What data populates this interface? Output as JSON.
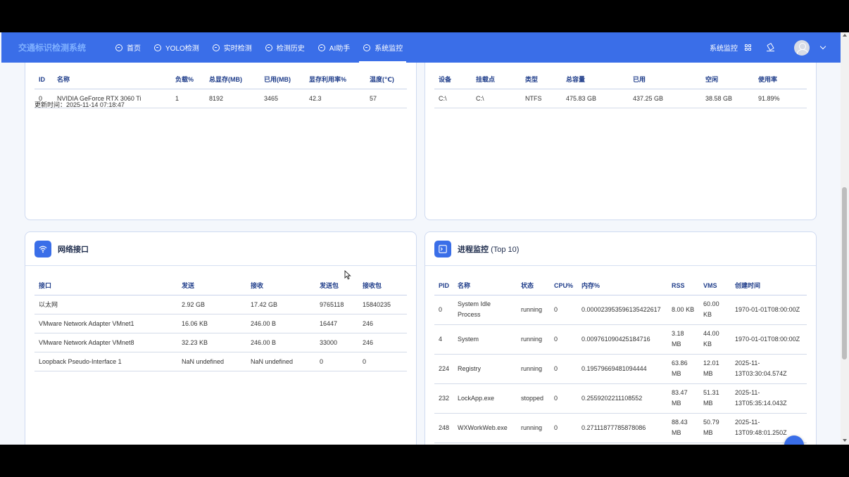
{
  "navbar": {
    "brand": "交通标识检测系统",
    "items": [
      {
        "label": "首页",
        "icon": "dashboard-icon"
      },
      {
        "label": "YOLO检测",
        "icon": "dashboard-icon"
      },
      {
        "label": "实时检测",
        "icon": "dashboard-icon"
      },
      {
        "label": "检测历史",
        "icon": "dashboard-icon"
      },
      {
        "label": "AI助手",
        "icon": "chat-icon"
      },
      {
        "label": "系统监控",
        "icon": "dashboard-icon",
        "active": true
      }
    ],
    "right_label": "系统监控",
    "accent_color": "#3a6ee8"
  },
  "gpu": {
    "headers": [
      "ID",
      "名称",
      "负载%",
      "总显存(MB)",
      "已用(MB)",
      "显存利用率%",
      "温度(℃)"
    ],
    "rows": [
      [
        "0",
        "NVIDIA GeForce RTX 3060 Ti",
        "1",
        "8192",
        "3465",
        "42.3",
        "57"
      ]
    ],
    "update_time": "更新时间：2025-11-14 07:18:47"
  },
  "disk": {
    "headers": [
      "设备",
      "挂载点",
      "类型",
      "总容量",
      "已用",
      "空闲",
      "使用率"
    ],
    "rows": [
      [
        "C:\\",
        "C:\\",
        "NTFS",
        "475.83 GB",
        "437.25 GB",
        "38.58 GB",
        "91.89%"
      ]
    ]
  },
  "network": {
    "title": "网络接口",
    "headers": [
      "接口",
      "发送",
      "接收",
      "发送包",
      "接收包"
    ],
    "rows": [
      [
        "以太网",
        "2.92 GB",
        "17.42 GB",
        "9765118",
        "15840235"
      ],
      [
        "VMware Network Adapter VMnet1",
        "16.06 KB",
        "246.00 B",
        "16447",
        "246"
      ],
      [
        "VMware Network Adapter VMnet8",
        "32.23 KB",
        "246.00 B",
        "33000",
        "246"
      ],
      [
        "Loopback Pseudo-Interface 1",
        "NaN undefined",
        "NaN undefined",
        "0",
        "0"
      ]
    ]
  },
  "process": {
    "title": "进程监控",
    "title_suffix": "(Top 10)",
    "headers": [
      "PID",
      "名称",
      "状态",
      "CPU%",
      "内存%",
      "RSS",
      "VMS",
      "创建时间"
    ],
    "rows": [
      {
        "pid": "0",
        "name": [
          "System Idle",
          "Process"
        ],
        "status": "running",
        "cpu": "0",
        "mem": "0.000023953596135422617",
        "rss": [
          "8.00 KB"
        ],
        "vms": [
          "60.00",
          "KB"
        ],
        "created": [
          "1970-01-01T08:00:00Z"
        ]
      },
      {
        "pid": "4",
        "name": [
          "System"
        ],
        "status": "running",
        "cpu": "0",
        "mem": "0.009761090425184716",
        "rss": [
          "3.18",
          "MB"
        ],
        "vms": [
          "44.00",
          "KB"
        ],
        "created": [
          "1970-01-01T08:00:00Z"
        ]
      },
      {
        "pid": "224",
        "name": [
          "Registry"
        ],
        "status": "running",
        "cpu": "0",
        "mem": "0.19579669481094444",
        "rss": [
          "63.86",
          "MB"
        ],
        "vms": [
          "12.01",
          "MB"
        ],
        "created": [
          "2025-11-",
          "13T03:30:04.574Z"
        ]
      },
      {
        "pid": "232",
        "name": [
          "LockApp.exe"
        ],
        "status": "stopped",
        "cpu": "0",
        "mem": "0.2559202211108552",
        "rss": [
          "83.47",
          "MB"
        ],
        "vms": [
          "51.31",
          "MB"
        ],
        "created": [
          "2025-11-",
          "13T05:35:14.043Z"
        ]
      },
      {
        "pid": "248",
        "name": [
          "WXWorkWeb.exe"
        ],
        "status": "running",
        "cpu": "0",
        "mem": "0.27111877785878086",
        "rss": [
          "88.43",
          "MB"
        ],
        "vms": [
          "50.79",
          "MB"
        ],
        "created": [
          "2025-11-",
          "13T09:48:01.250Z"
        ]
      }
    ]
  }
}
